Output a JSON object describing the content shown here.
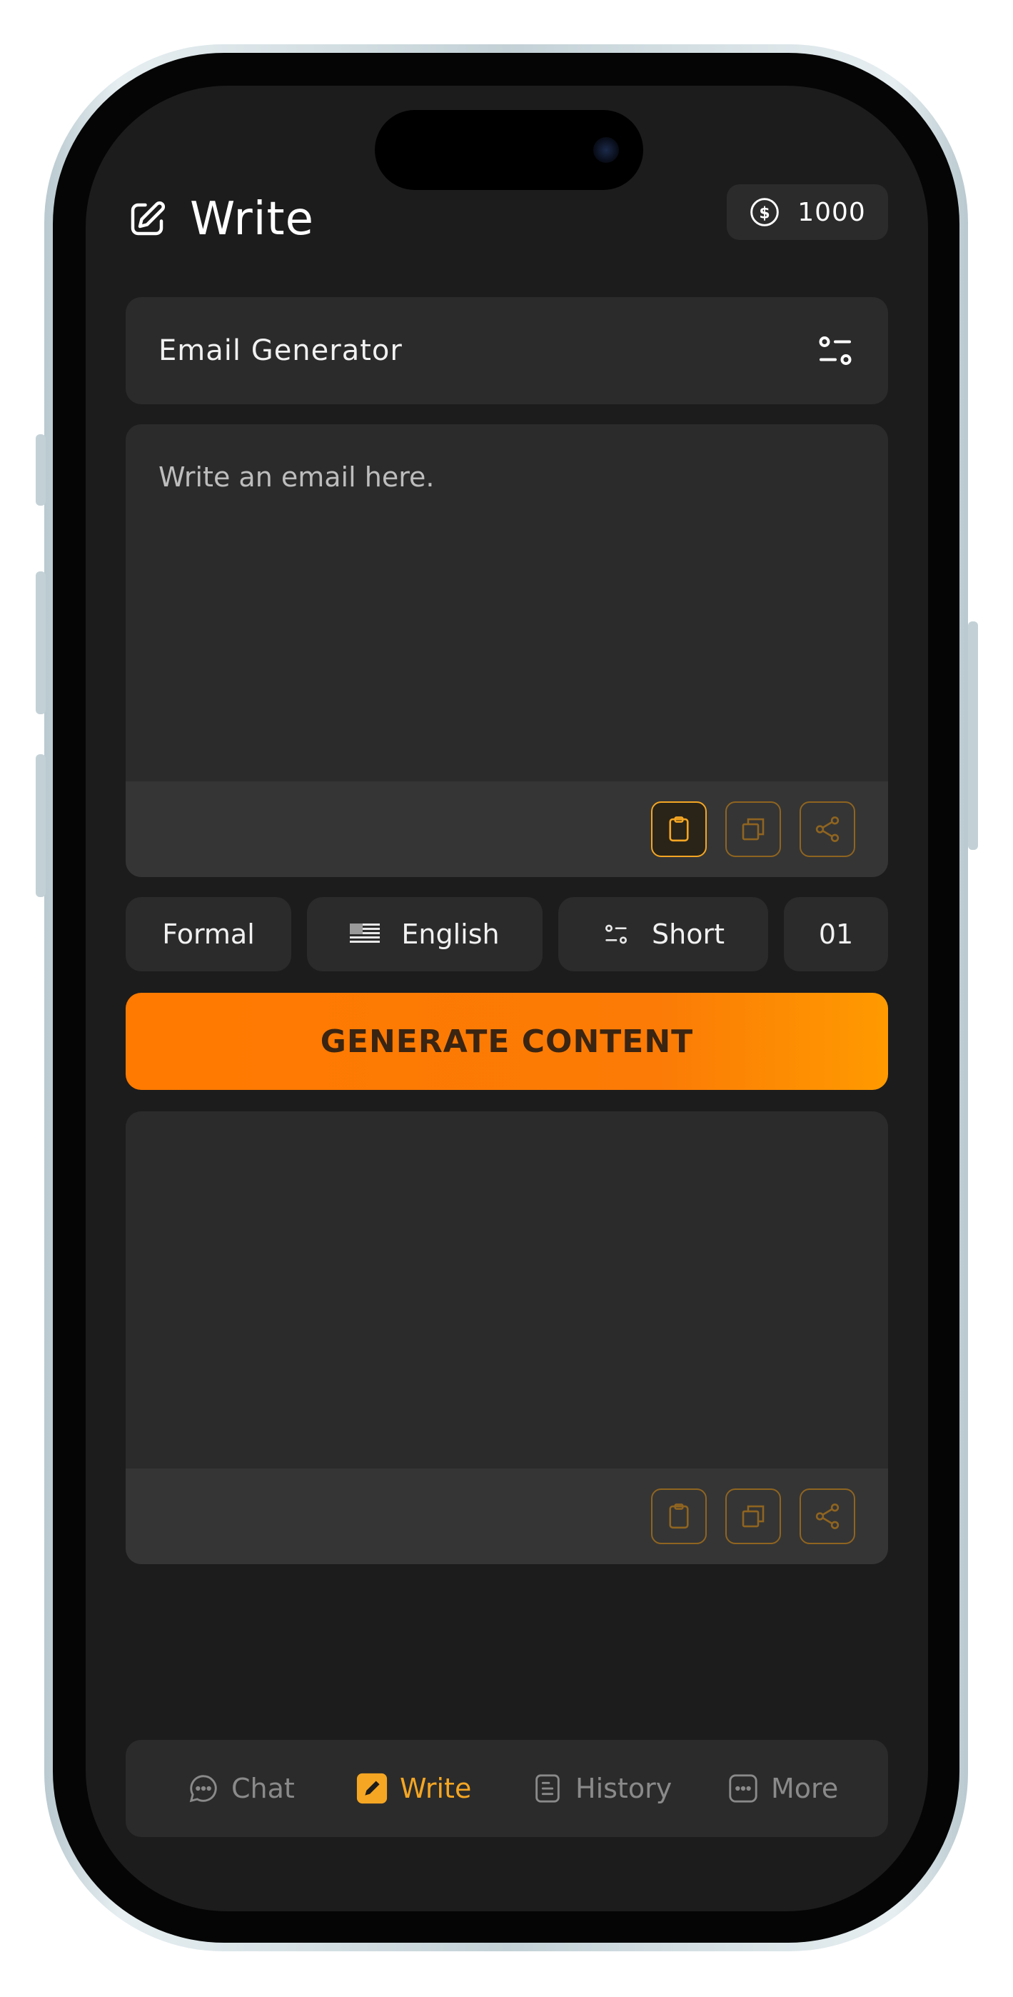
{
  "header": {
    "title": "Write",
    "credits": "1000"
  },
  "generator": {
    "label": "Email Generator"
  },
  "input": {
    "placeholder": "Write an email here."
  },
  "options": {
    "tone": "Formal",
    "language": "English",
    "length": "Short",
    "count": "01"
  },
  "generate_button": {
    "label": "GENERATE CONTENT"
  },
  "tabs": [
    {
      "label": "Chat",
      "icon": "chat-bubble-icon",
      "active": false
    },
    {
      "label": "Write",
      "icon": "pencil-icon",
      "active": true
    },
    {
      "label": "History",
      "icon": "document-list-icon",
      "active": false
    },
    {
      "label": "More",
      "icon": "ellipsis-icon",
      "active": false
    }
  ],
  "colors": {
    "accent": "#f5a623",
    "background": "#1c1c1c",
    "card": "#2b2b2b",
    "button_gradient_start": "#ff7a00",
    "button_gradient_end": "#ff9a00"
  }
}
